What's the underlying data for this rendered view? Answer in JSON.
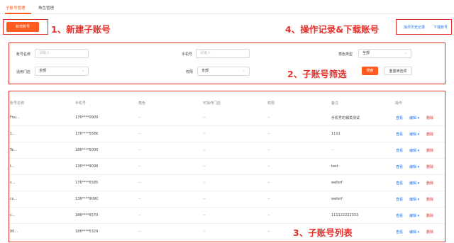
{
  "tabs": [
    {
      "label": "子账号管理",
      "active": true
    },
    {
      "label": "角色管理",
      "active": false
    }
  ],
  "toolbar": {
    "new_button": "新增账号",
    "history_link": "操作历史记录",
    "download_link": "下载账号"
  },
  "annotations": {
    "a1": "1、新建子账号",
    "a2": "2、子账号筛选",
    "a3": "3、子账号列表",
    "a4": "4、操作记录&下载账号"
  },
  "filters": {
    "account_name": {
      "label": "账号名称",
      "placeholder": "请输入"
    },
    "phone": {
      "label": "手机号",
      "placeholder": "请输入"
    },
    "role_type": {
      "label": "角色类型",
      "value": "全部"
    },
    "store": {
      "label": "适用门店",
      "value": "全部"
    },
    "permission": {
      "label": "权限",
      "value": "全部"
    },
    "search_button": "搜索",
    "reset_button": "重置筛选项"
  },
  "table": {
    "headers": [
      "账号名称",
      "手机号",
      "角色",
      "可操作门店",
      "权限",
      "备注",
      "操作"
    ],
    "rows": [
      {
        "name": "Fou...",
        "phone": "176****0909",
        "role": "--",
        "store": "--",
        "perm": "--",
        "note": "手机号的相关测试"
      },
      {
        "name": "1...",
        "phone": "176****5586",
        "role": "--",
        "store": "--",
        "perm": "--",
        "note": "1111"
      },
      {
        "name": "Te...",
        "phone": "186****5000",
        "role": "--",
        "store": "--",
        "perm": "--",
        "note": "--"
      },
      {
        "name": "t...",
        "phone": "136****9098",
        "role": "--",
        "store": "--",
        "perm": "--",
        "note": "test"
      },
      {
        "name": "c...",
        "phone": "176****5585",
        "role": "--",
        "store": "--",
        "perm": "--",
        "note": "weferf"
      },
      {
        "name": "cs...",
        "phone": "136****9090",
        "role": "--",
        "store": "--",
        "perm": "--",
        "note": "weferf"
      },
      {
        "name": "c...",
        "phone": "186****5570",
        "role": "--",
        "store": "--",
        "perm": "--",
        "note": "111122222333"
      },
      {
        "name": "00...",
        "phone": "186****5329",
        "role": "--",
        "store": "--",
        "perm": "--",
        "note": "--"
      }
    ],
    "ops": {
      "view": "查看",
      "edit": "编辑 ▾",
      "delete": "删除"
    }
  },
  "colors": {
    "accent": "#ff5a1f",
    "annotation": "#e5302a",
    "link": "#1677ff"
  },
  "icons": {
    "dropdown": "chevron-down-icon"
  }
}
